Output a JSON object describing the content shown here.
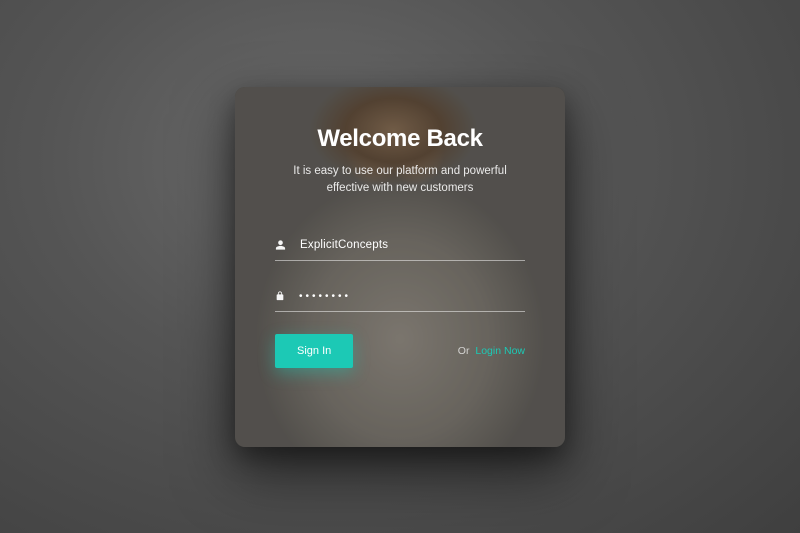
{
  "title": "Welcome Back",
  "subtitle_line1": "It is easy to use our platform and powerful",
  "subtitle_line2": "effective with new customers",
  "username": {
    "value": "ExplicitConcepts"
  },
  "password": {
    "value": "••••••••"
  },
  "signin_label": "Sign In",
  "or_text": "Or",
  "login_link": "Login Now",
  "colors": {
    "accent": "#1cc9b5"
  }
}
